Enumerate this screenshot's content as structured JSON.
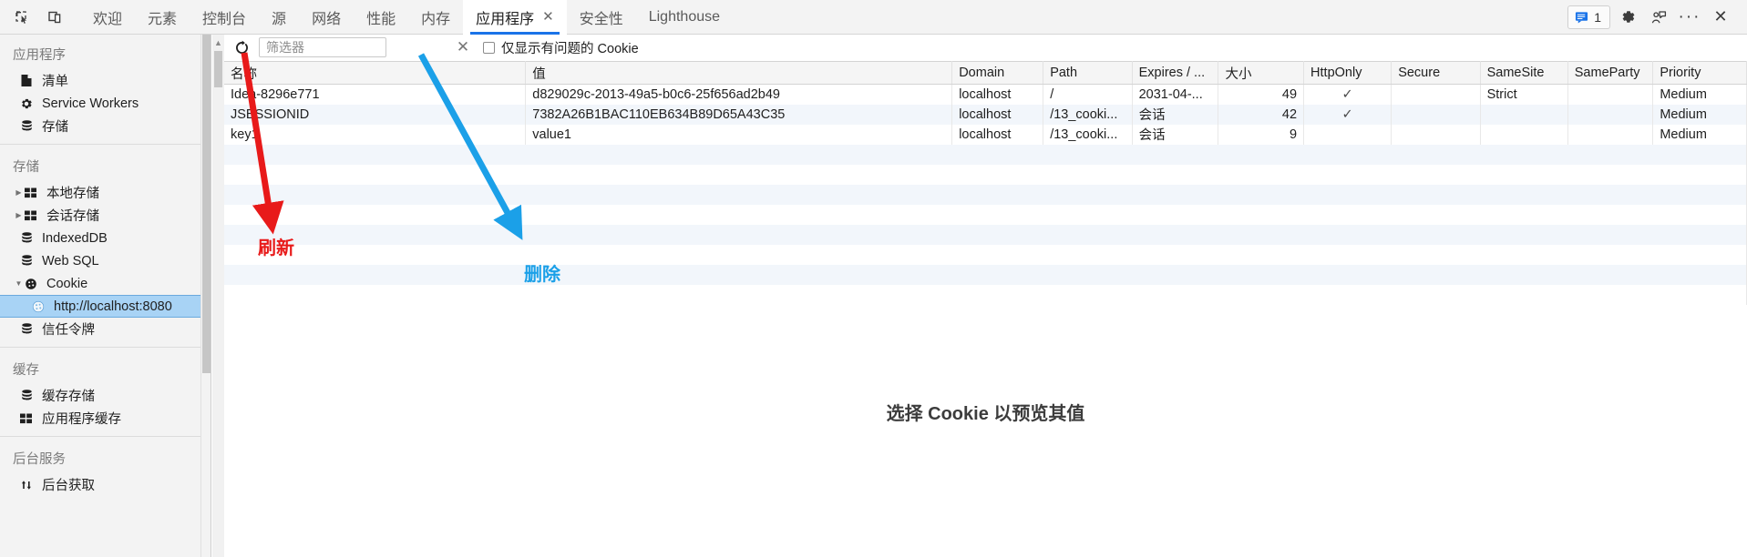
{
  "toolbar": {
    "left_icons": [
      {
        "name": "inspect-element-icon",
        "label": "检查元素"
      },
      {
        "name": "device-toolbar-icon",
        "label": "切换设备工具栏"
      }
    ],
    "tabs": [
      {
        "label": "欢迎",
        "active": false,
        "closable": false
      },
      {
        "label": "元素",
        "active": false,
        "closable": false
      },
      {
        "label": "控制台",
        "active": false,
        "closable": false
      },
      {
        "label": "源",
        "active": false,
        "closable": false
      },
      {
        "label": "网络",
        "active": false,
        "closable": false
      },
      {
        "label": "性能",
        "active": false,
        "closable": false
      },
      {
        "label": "内存",
        "active": false,
        "closable": false
      },
      {
        "label": "应用程序",
        "active": true,
        "closable": true
      },
      {
        "label": "安全性",
        "active": false,
        "closable": false
      },
      {
        "label": "Lighthouse",
        "active": false,
        "closable": false
      }
    ],
    "tab_close_glyph": "✕",
    "message_count": "1",
    "right_icons": [
      {
        "name": "message-badge",
        "label": "1"
      },
      {
        "name": "gear-icon",
        "label": "设置"
      },
      {
        "name": "feedback-icon",
        "label": "反馈"
      },
      {
        "name": "more-options-icon",
        "label": "更多选项"
      },
      {
        "name": "close-devtools-icon",
        "label": "关闭"
      }
    ],
    "more_glyph": "···",
    "close_glyph": "✕"
  },
  "sidebar": {
    "sections": [
      {
        "title": "应用程序",
        "items": [
          {
            "label": "清单",
            "icon": "manifest-document-icon",
            "arrow": "",
            "indent": 1
          },
          {
            "label": "Service Workers",
            "icon": "gear-icon",
            "arrow": "",
            "indent": 1
          },
          {
            "label": "存储",
            "icon": "database-icon",
            "arrow": "",
            "indent": 1
          }
        ]
      },
      {
        "title": "存储",
        "items": [
          {
            "label": "本地存储",
            "icon": "table-grid-icon",
            "arrow": "▶",
            "indent": 0
          },
          {
            "label": "会话存储",
            "icon": "table-grid-icon",
            "arrow": "▶",
            "indent": 0
          },
          {
            "label": "IndexedDB",
            "icon": "database-icon",
            "arrow": "",
            "indent": 1
          },
          {
            "label": "Web SQL",
            "icon": "database-icon",
            "arrow": "",
            "indent": 1
          },
          {
            "label": "Cookie",
            "icon": "cookie-icon",
            "arrow": "▼",
            "indent": 0
          },
          {
            "label": "http://localhost:8080",
            "icon": "cookie-icon-light",
            "arrow": "",
            "indent": 2,
            "selected": true
          },
          {
            "label": "信任令牌",
            "icon": "database-icon",
            "arrow": "",
            "indent": 1
          }
        ]
      },
      {
        "title": "缓存",
        "items": [
          {
            "label": "缓存存储",
            "icon": "database-icon",
            "arrow": "",
            "indent": 1
          },
          {
            "label": "应用程序缓存",
            "icon": "table-grid-icon",
            "arrow": "",
            "indent": 1
          }
        ]
      },
      {
        "title": "后台服务",
        "items": [
          {
            "label": "后台获取",
            "icon": "updown-arrows-icon",
            "arrow": "",
            "indent": 1
          }
        ]
      }
    ]
  },
  "filterbar": {
    "refresh_label": "刷新",
    "filter_placeholder": "筛选器",
    "filter_value": "",
    "clear_label": "清除",
    "clear_glyph": "✕",
    "only_issues_label": "仅显示有问题的 Cookie",
    "only_issues_checked": false
  },
  "table": {
    "columns": [
      "名称",
      "值",
      "Domain",
      "Path",
      "Expires / ...",
      "大小",
      "HttpOnly",
      "Secure",
      "SameSite",
      "SameParty",
      "Priority"
    ],
    "rows": [
      {
        "名称": "Idea-8296e771",
        "值": "d829029c-2013-49a5-b0c6-25f656ad2b49",
        "Domain": "localhost",
        "Path": "/",
        "Expires / ...": "2031-04-...",
        "大小": "49",
        "HttpOnly": "✓",
        "Secure": "",
        "SameSite": "Strict",
        "SameParty": "",
        "Priority": "Medium"
      },
      {
        "名称": "JSESSIONID",
        "值": "7382A26B1BAC110EB634B89D65A43C35",
        "Domain": "localhost",
        "Path": "/13_cooki...",
        "Expires / ...": "会话",
        "大小": "42",
        "HttpOnly": "✓",
        "Secure": "",
        "SameSite": "",
        "SameParty": "",
        "Priority": "Medium"
      },
      {
        "名称": "key1",
        "值": "value1",
        "Domain": "localhost",
        "Path": "/13_cooki...",
        "Expires / ...": "会话",
        "大小": "9",
        "HttpOnly": "",
        "Secure": "",
        "SameSite": "",
        "SameParty": "",
        "Priority": "Medium"
      }
    ],
    "blank_row_count": 8
  },
  "annotations": [
    {
      "name": "refresh-annotation",
      "label": "刷新",
      "color": "#e81a1a"
    },
    {
      "name": "delete-annotation",
      "label": "删除",
      "color": "#1ba0e8"
    }
  ],
  "preview": {
    "message": "选择 Cookie 以预览其值"
  },
  "colors": {
    "accent": "#1a73e8",
    "selection": "#a8d3f5",
    "annotation_red": "#e81a1a",
    "annotation_blue": "#1ba0e8"
  }
}
